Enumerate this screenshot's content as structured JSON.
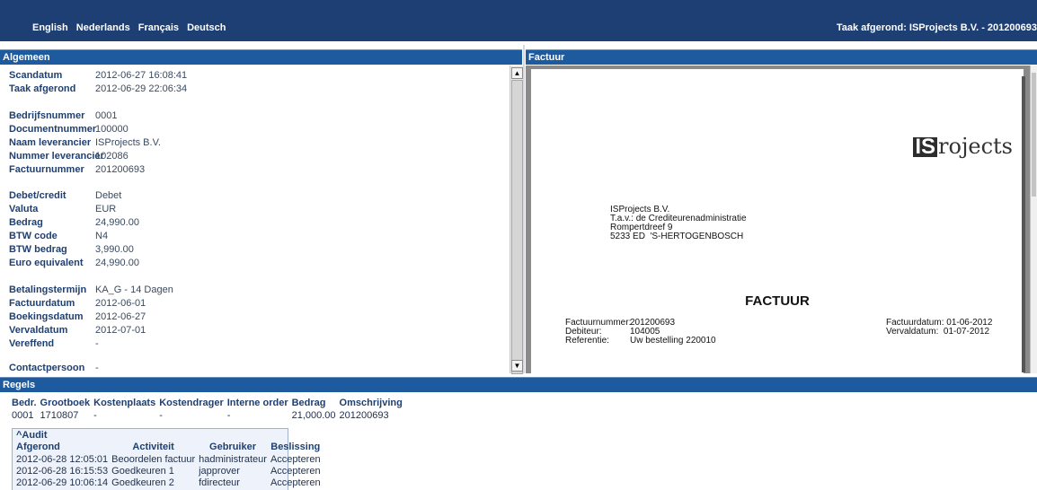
{
  "languages": [
    "English",
    "Nederlands",
    "Français",
    "Deutsch"
  ],
  "task_title": "Taak afgerond: ISProjects B.V. - 201200693",
  "panels": {
    "general": "Algemeen",
    "invoice": "Factuur",
    "lines": "Regels"
  },
  "general_fields": [
    {
      "label": "Scandatum",
      "value": "2012-06-27 16:08:41"
    },
    {
      "label": "Taak afgerond",
      "value": "2012-06-29 22:06:34"
    },
    {
      "label": "Bedrijfsnummer",
      "value": "0001"
    },
    {
      "label": "Documentnummer",
      "value": "100000"
    },
    {
      "label": "Naam leverancier",
      "value": "ISProjects B.V."
    },
    {
      "label": "Nummer leverancier",
      "value": "102086"
    },
    {
      "label": "Factuurnummer",
      "value": "201200693"
    },
    {
      "label": "Debet/credit",
      "value": "Debet"
    },
    {
      "label": "Valuta",
      "value": "EUR"
    },
    {
      "label": "Bedrag",
      "value": "24,990.00"
    },
    {
      "label": "BTW code",
      "value": "N4"
    },
    {
      "label": "BTW bedrag",
      "value": "3,990.00"
    },
    {
      "label": "Euro equivalent",
      "value": "24,990.00"
    },
    {
      "label": "Betalingstermijn",
      "value": "KA_G - 14 Dagen"
    },
    {
      "label": "Factuurdatum",
      "value": "2012-06-01"
    },
    {
      "label": "Boekingsdatum",
      "value": "2012-06-27"
    },
    {
      "label": "Vervaldatum",
      "value": "2012-07-01"
    },
    {
      "label": "Vereffend",
      "value": "-"
    },
    {
      "label": "Contactpersoon",
      "value": "-"
    }
  ],
  "invoice": {
    "logo_box": "IS",
    "logo_text": "rojects",
    "address": [
      "ISProjects B.V.",
      "T.a.v.: de Crediteurenadministratie",
      "Rompertdreef 9",
      "5233 ED  'S-HERTOGENBOSCH"
    ],
    "title": "FACTUUR",
    "meta_left": [
      {
        "k": "Factuurnummer:",
        "v": "201200693"
      },
      {
        "k": "Debiteur:",
        "v": "104005"
      },
      {
        "k": "Referentie:",
        "v": "Uw bestelling 220010"
      }
    ],
    "meta_right": [
      "Factuurdatum: 01-06-2012",
      "Vervaldatum:  01-07-2012"
    ]
  },
  "lines": {
    "headers": [
      "Bedr.",
      "Grootboek",
      "Kostenplaats",
      "Kostendrager",
      "Interne order",
      "Bedrag",
      "Omschrijving"
    ],
    "rows": [
      [
        "0001",
        "1710807",
        "-",
        "-",
        "-",
        "21,000.00",
        "201200693"
      ]
    ]
  },
  "audit": {
    "toggle": "^Audit",
    "headers": [
      "Afgerond",
      "Activiteit",
      "Gebruiker",
      "Beslissing"
    ],
    "rows": [
      [
        "2012-06-28 12:05:01",
        "Beoordelen factuur",
        "hadministrateur",
        "Accepteren"
      ],
      [
        "2012-06-28 16:15:53",
        "Goedkeuren 1",
        "japprover",
        "Accepteren"
      ],
      [
        "2012-06-29 10:06:14",
        "Goedkeuren 2",
        "fdirecteur",
        "Accepteren"
      ]
    ]
  },
  "colors": {
    "topbar": "#1e3f74",
    "panel_header": "#1e5a9e",
    "label": "#1f3f70"
  }
}
